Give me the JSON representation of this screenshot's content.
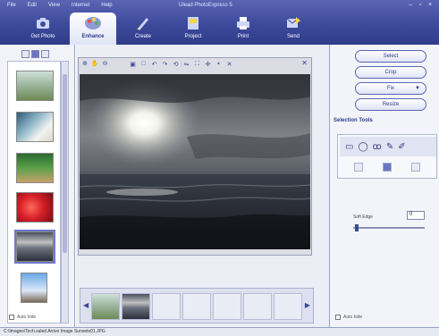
{
  "menu": [
    "File",
    "Edit",
    "View",
    "Internet",
    "Help"
  ],
  "app_title": "Ulead PhotoExpress 5",
  "window_controls": [
    "–",
    "▫",
    "×"
  ],
  "toolbar": [
    {
      "label": "Get Photo",
      "icon": "camera-icon"
    },
    {
      "label": "Enhance",
      "icon": "palette-icon",
      "active": true
    },
    {
      "label": "Create",
      "icon": "brush-icon"
    },
    {
      "label": "Project",
      "icon": "book-icon"
    },
    {
      "label": "Print",
      "icon": "printer-icon"
    },
    {
      "label": "Send",
      "icon": "send-icon"
    }
  ],
  "right_panel": {
    "buttons": [
      "Select",
      "Crop",
      "Fix",
      "Resize"
    ],
    "section_title": "Selection Tools",
    "feather_label": "Soft Edge",
    "feather_value": "0",
    "auto_hide": "Auto hide"
  },
  "left_panel": {
    "auto_hide": "Auto hide"
  },
  "status_text": "C:\\Images\\Tech.saled  Arrive Image Sunsets01.JPG",
  "colors": {
    "accent": "#3d4a9c",
    "panel": "#f3f4fa"
  }
}
